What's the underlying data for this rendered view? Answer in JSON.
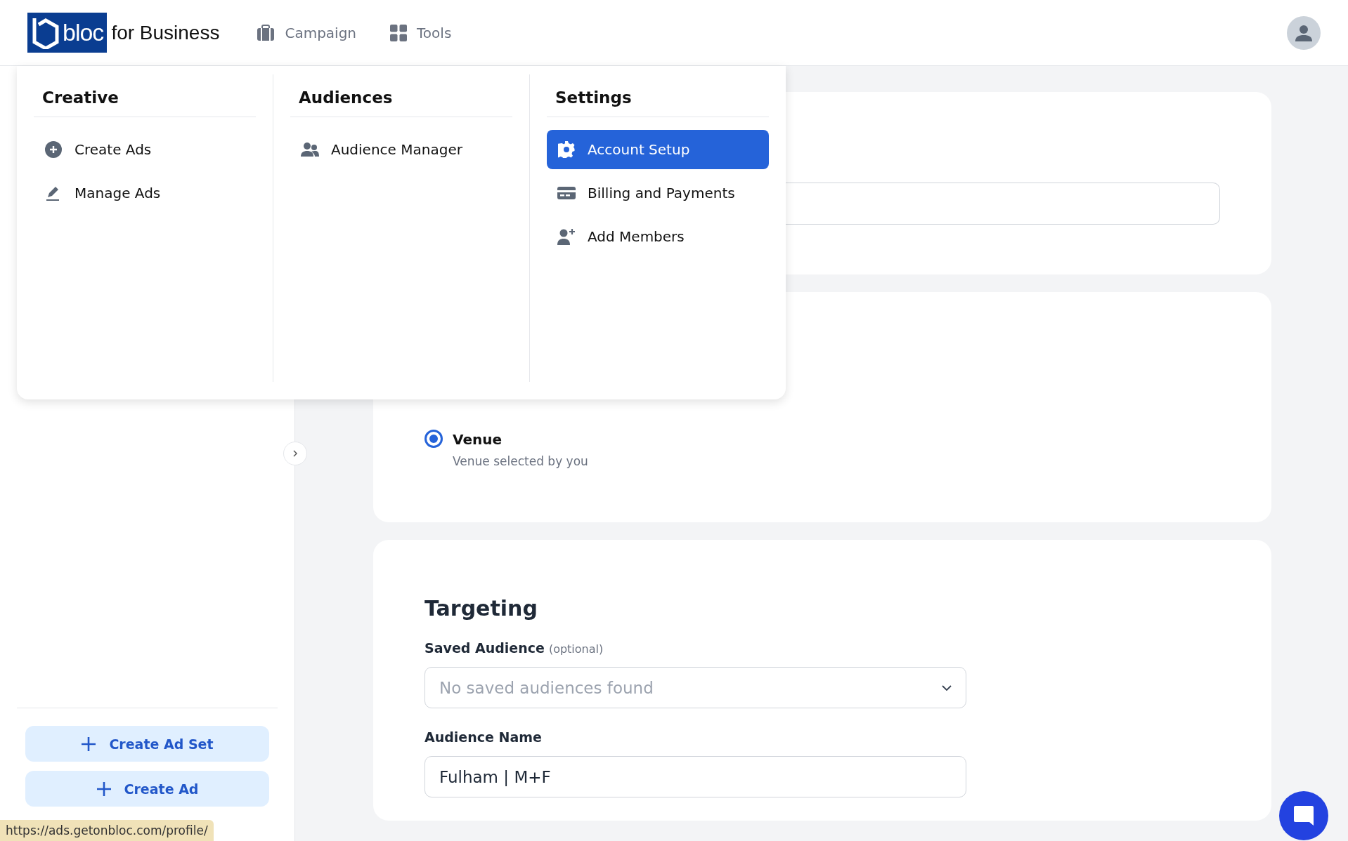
{
  "header": {
    "logo": {
      "wordmark": "bloc",
      "suffix": "for Business"
    },
    "nav": [
      {
        "label": "Campaign"
      },
      {
        "label": "Tools"
      }
    ]
  },
  "menu": {
    "columns": [
      {
        "title": "Creative",
        "items": [
          {
            "label": "Create Ads",
            "selected": false
          },
          {
            "label": "Manage Ads",
            "selected": false
          }
        ]
      },
      {
        "title": "Audiences",
        "items": [
          {
            "label": "Audience Manager",
            "selected": false
          }
        ]
      },
      {
        "title": "Settings",
        "items": [
          {
            "label": "Account Setup",
            "selected": true
          },
          {
            "label": "Billing and Payments",
            "selected": false
          },
          {
            "label": "Add Members",
            "selected": false
          }
        ]
      }
    ]
  },
  "sidebar": {
    "actions": [
      "Create Ad Set",
      "Create Ad"
    ]
  },
  "placement": {
    "option": {
      "label": "Venue",
      "description": "Venue selected by you",
      "selected": true
    }
  },
  "targeting": {
    "title": "Targeting",
    "saved_audience": {
      "label": "Saved Audience",
      "hint": "(optional)",
      "placeholder": "No saved audiences found"
    },
    "audience_name": {
      "label": "Audience Name",
      "value": "Fulham | M+F"
    }
  },
  "status_url": "https://ads.getonbloc.com/profile/"
}
